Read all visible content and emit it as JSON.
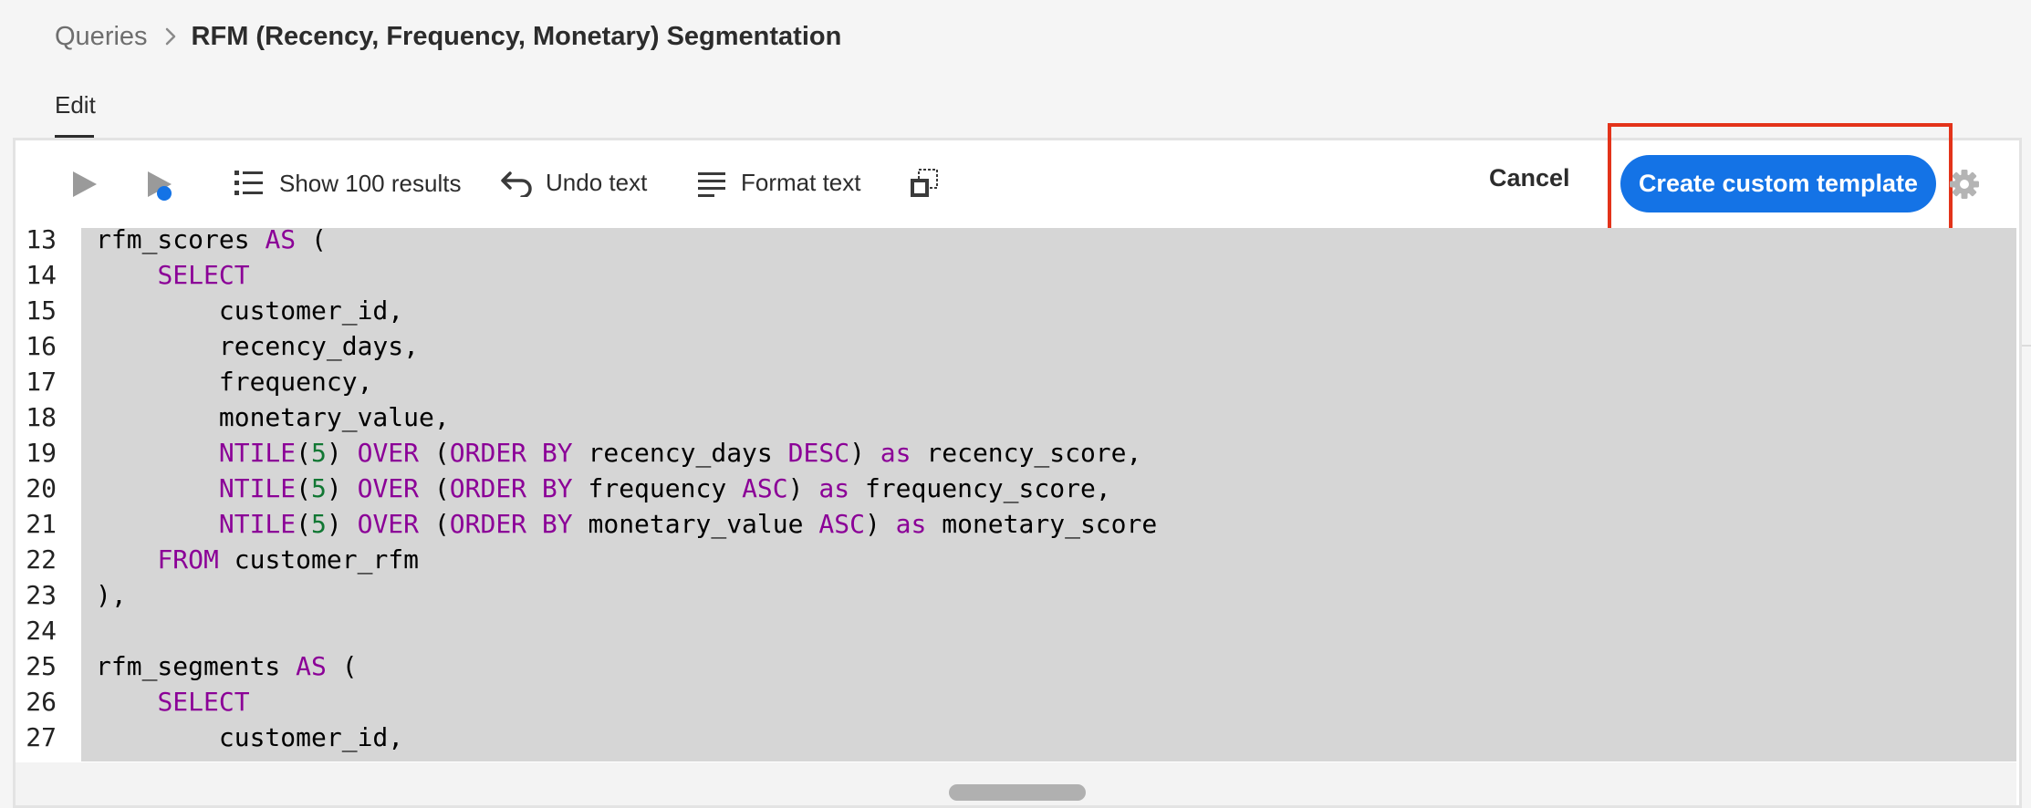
{
  "breadcrumb": {
    "parent": "Queries",
    "current": "RFM (Recency, Frequency, Monetary) Segmentation"
  },
  "tabs": [
    {
      "label": "Edit",
      "active": true
    }
  ],
  "toolbar": {
    "show_results_label": "Show 100 results",
    "undo_label": "Undo text",
    "format_label": "Format text",
    "cancel_label": "Cancel",
    "create_template_label": "Create custom template",
    "icons": [
      "play-icon",
      "run-selection-icon",
      "list-icon",
      "undo-icon",
      "format-icon",
      "copy-icon",
      "gear-icon"
    ]
  },
  "colors": {
    "primary": "#1473e6",
    "highlight": "#e3331a",
    "keyword": "#8b0097",
    "number": "#117733",
    "selection": "#d6d6d6"
  },
  "editor": {
    "lines": [
      {
        "n": "13",
        "code": "rfm_scores AS ("
      },
      {
        "n": "14",
        "code": "    SELECT"
      },
      {
        "n": "15",
        "code": "        customer_id,"
      },
      {
        "n": "16",
        "code": "        recency_days,"
      },
      {
        "n": "17",
        "code": "        frequency,"
      },
      {
        "n": "18",
        "code": "        monetary_value,"
      },
      {
        "n": "19",
        "code": "        NTILE(5) OVER (ORDER BY recency_days DESC) as recency_score,"
      },
      {
        "n": "20",
        "code": "        NTILE(5) OVER (ORDER BY frequency ASC) as frequency_score,"
      },
      {
        "n": "21",
        "code": "        NTILE(5) OVER (ORDER BY monetary_value ASC) as monetary_score"
      },
      {
        "n": "22",
        "code": "    FROM customer_rfm"
      },
      {
        "n": "23",
        "code": "),"
      },
      {
        "n": "24",
        "code": ""
      },
      {
        "n": "25",
        "code": "rfm_segments AS ("
      },
      {
        "n": "26",
        "code": "    SELECT"
      },
      {
        "n": "27",
        "code": "        customer_id,"
      }
    ]
  }
}
